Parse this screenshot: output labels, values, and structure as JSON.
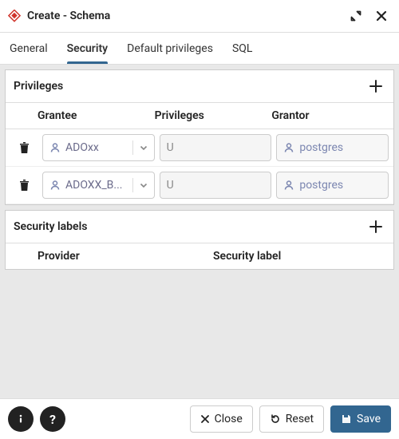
{
  "window": {
    "title": "Create - Schema"
  },
  "tabs": [
    {
      "label": "General",
      "active": false
    },
    {
      "label": "Security",
      "active": true
    },
    {
      "label": "Default privileges",
      "active": false
    },
    {
      "label": "SQL",
      "active": false
    }
  ],
  "privileges": {
    "title": "Privileges",
    "columns": {
      "grantee": "Grantee",
      "privileges": "Privileges",
      "grantor": "Grantor"
    },
    "rows": [
      {
        "grantee": "ADOxx",
        "privileges": "U",
        "grantor": "postgres"
      },
      {
        "grantee": "ADOXX_B...",
        "privileges": "U",
        "grantor": "postgres"
      }
    ]
  },
  "security_labels": {
    "title": "Security labels",
    "columns": {
      "provider": "Provider",
      "label": "Security label"
    }
  },
  "footer": {
    "close": "Close",
    "reset": "Reset",
    "save": "Save"
  },
  "colors": {
    "accent": "#326690"
  }
}
